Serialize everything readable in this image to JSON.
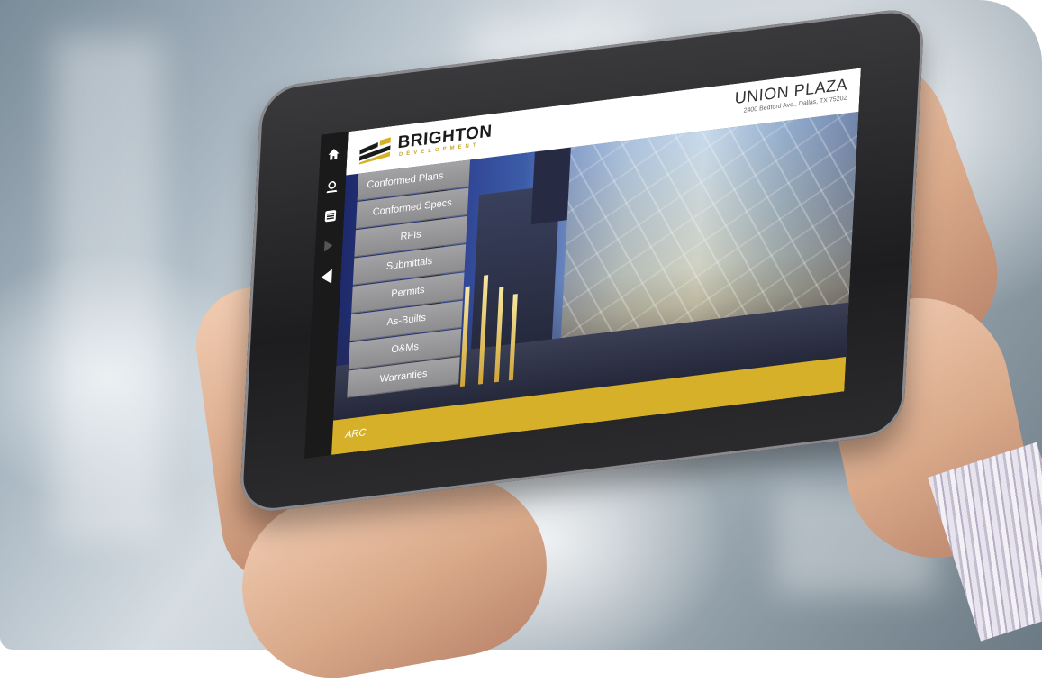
{
  "brand": {
    "name": "BRIGHTON",
    "subtitle": "DEVELOPMENT"
  },
  "project": {
    "title": "UNION PLAZA",
    "address": "2400 Bedford Ave., Dallas, TX 75202"
  },
  "rail": {
    "icons": [
      "home-icon",
      "location-pin-icon",
      "list-icon",
      "expand-arrow-icon",
      "collapse-arrow-icon"
    ]
  },
  "menu": {
    "items": [
      {
        "label": "Conformed Plans"
      },
      {
        "label": "Conformed Specs"
      },
      {
        "label": "RFIs"
      },
      {
        "label": "Submittals"
      },
      {
        "label": "Permits"
      },
      {
        "label": "As-Builts"
      },
      {
        "label": "O&Ms"
      },
      {
        "label": "Warranties"
      }
    ]
  },
  "footer": {
    "brand_label": "ARC"
  },
  "colors": {
    "accent_gold": "#d7b02a",
    "menu_gray": "#98989b",
    "rail_dark": "#1a1a1a"
  }
}
